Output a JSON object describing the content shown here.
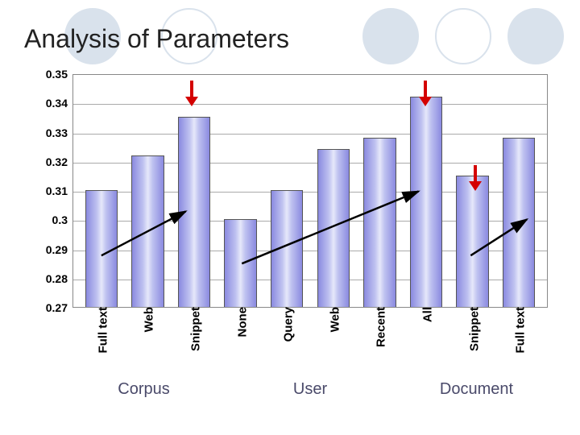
{
  "title": "Analysis of Parameters",
  "chart_data": {
    "type": "bar",
    "ylabel": "",
    "xlabel": "",
    "ylim": [
      0.27,
      0.35
    ],
    "yticks": [
      0.27,
      0.28,
      0.29,
      0.3,
      0.31,
      0.32,
      0.33,
      0.34,
      0.35
    ],
    "categories": [
      "Full text",
      "Web",
      "Snippet",
      "None",
      "Query",
      "Web",
      "Recent",
      "All",
      "Snippet",
      "Full text"
    ],
    "values": [
      0.31,
      0.322,
      0.335,
      0.3,
      0.31,
      0.324,
      0.328,
      0.342,
      0.315,
      0.328
    ],
    "groups": [
      {
        "label": "Corpus",
        "span": 3
      },
      {
        "label": "User",
        "span": 4
      },
      {
        "label": "Document",
        "span": 3
      }
    ],
    "annotations": {
      "red_down_arrows_at_index": [
        2,
        7,
        8
      ],
      "black_trend_arrows": [
        "corpus_increasing",
        "user_increasing",
        "document_increasing"
      ]
    }
  },
  "colors": {
    "bar_fill": "#a8aae8",
    "accent_red": "#d40000",
    "group_text": "#4a4a6a"
  }
}
